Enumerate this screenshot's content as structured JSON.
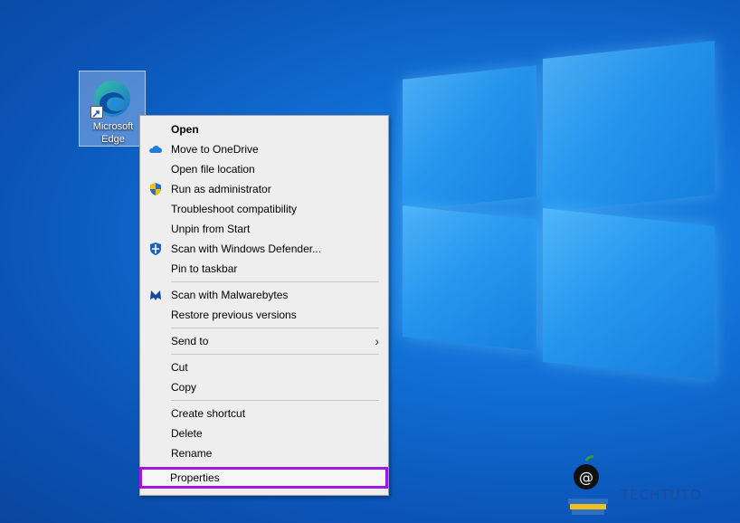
{
  "desktop": {
    "icon": {
      "label_line1": "Microsoft",
      "label_line2": "Edge"
    }
  },
  "context_menu": {
    "items": [
      {
        "label": "Open",
        "bold": true,
        "icon": "none"
      },
      {
        "label": "Move to OneDrive",
        "icon": "onedrive-cloud-icon"
      },
      {
        "label": "Open file location",
        "icon": "none"
      },
      {
        "label": "Run as administrator",
        "icon": "uac-shield-icon"
      },
      {
        "label": "Troubleshoot compatibility",
        "icon": "none"
      },
      {
        "label": "Unpin from Start",
        "icon": "none"
      },
      {
        "label": "Scan with Windows Defender...",
        "icon": "defender-shield-icon"
      },
      {
        "label": "Pin to taskbar",
        "icon": "none"
      },
      {
        "label": "Scan with Malwarebytes",
        "icon": "malwarebytes-icon"
      },
      {
        "label": "Restore previous versions",
        "icon": "none"
      },
      {
        "label": "Send to",
        "icon": "none",
        "submenu": true
      },
      {
        "label": "Cut",
        "icon": "none"
      },
      {
        "label": "Copy",
        "icon": "none"
      },
      {
        "label": "Create shortcut",
        "icon": "none"
      },
      {
        "label": "Delete",
        "icon": "none"
      },
      {
        "label": "Rename",
        "icon": "none"
      },
      {
        "label": "Properties",
        "icon": "none",
        "highlighted": true
      }
    ]
  },
  "watermark": {
    "text": "TECHTUTO"
  },
  "colors": {
    "highlight_border": "#a018d8",
    "menu_bg": "#eeeeee",
    "desktop_bg": "#0b55b8"
  }
}
